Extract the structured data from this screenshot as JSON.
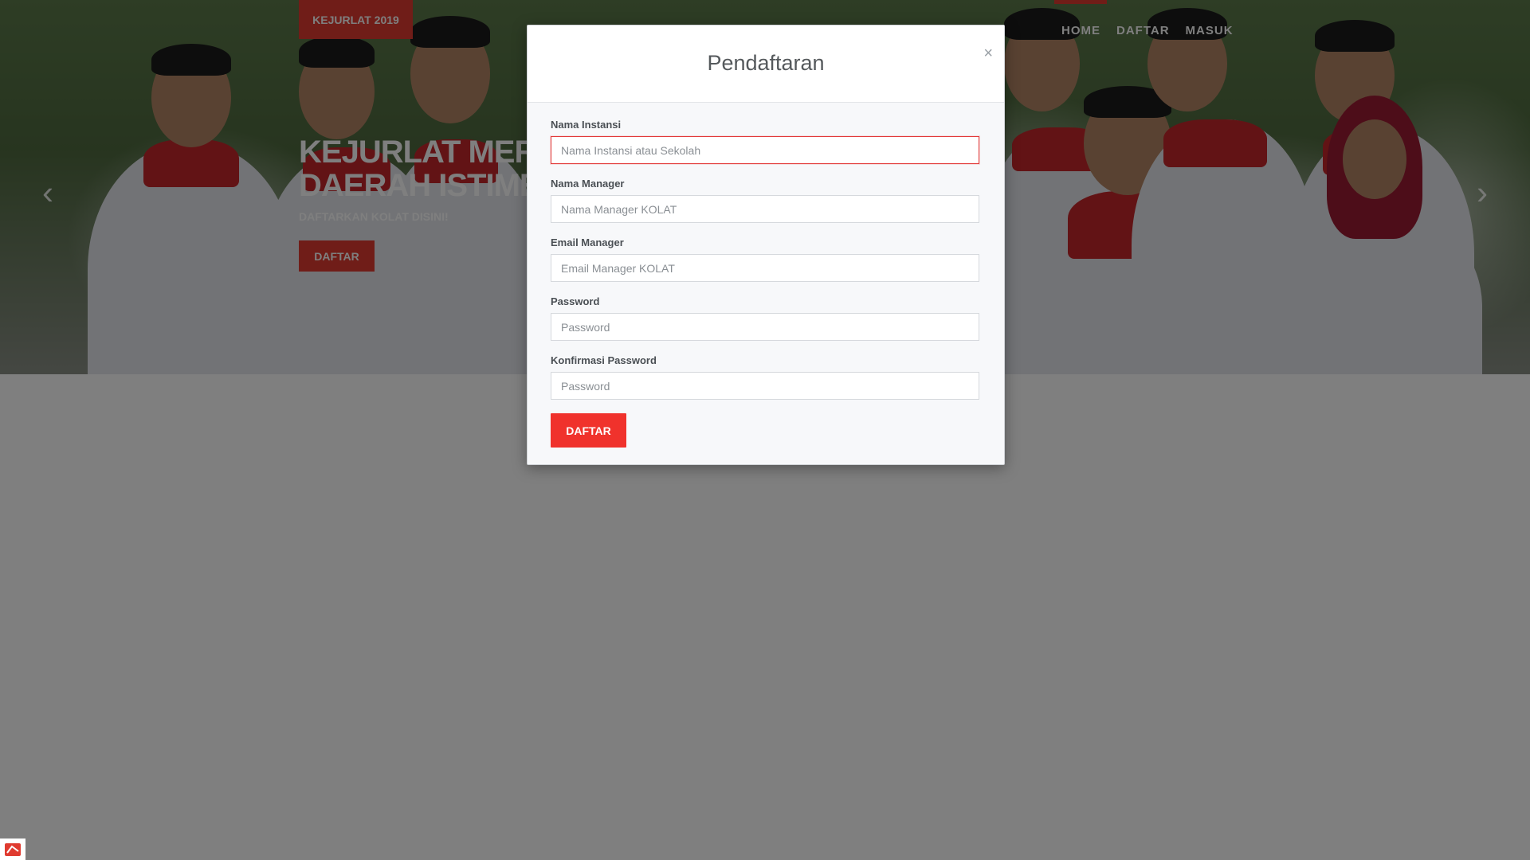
{
  "header": {
    "brand": "KEJURLAT 2019",
    "nav": {
      "home": "HOME",
      "daftar": "DAFTAR",
      "masuk": "MASUK"
    }
  },
  "hero": {
    "title": "KEJURLAT MERPA\nDAERAH ISTIMEW",
    "subtitle": "DAFTARKAN KOLAT DISINI!",
    "button": "DAFTAR",
    "prev_icon": "‹",
    "next_icon": "›"
  },
  "modal": {
    "title": "Pendaftaran",
    "close": "×",
    "fields": [
      {
        "label": "Nama Instansi",
        "placeholder": "Nama Instansi atau Sekolah",
        "value": ""
      },
      {
        "label": "Nama Manager",
        "placeholder": "Nama Manager KOLAT",
        "value": ""
      },
      {
        "label": "Email Manager",
        "placeholder": "Email Manager KOLAT",
        "value": ""
      },
      {
        "label": "Password",
        "placeholder": "Password",
        "value": ""
      },
      {
        "label": "Konfirmasi Password",
        "placeholder": "Password",
        "value": ""
      }
    ],
    "submit": "DAFTAR"
  },
  "colors": {
    "accent": "#e03b30",
    "submit": "#f0322c",
    "focus_border": "#e23a3a",
    "overlay": "rgba(0,0,0,0.5)"
  },
  "icons": {
    "close": "close-icon",
    "prev": "chevron-left-icon",
    "next": "chevron-right-icon",
    "corner": "app-logo-icon"
  }
}
